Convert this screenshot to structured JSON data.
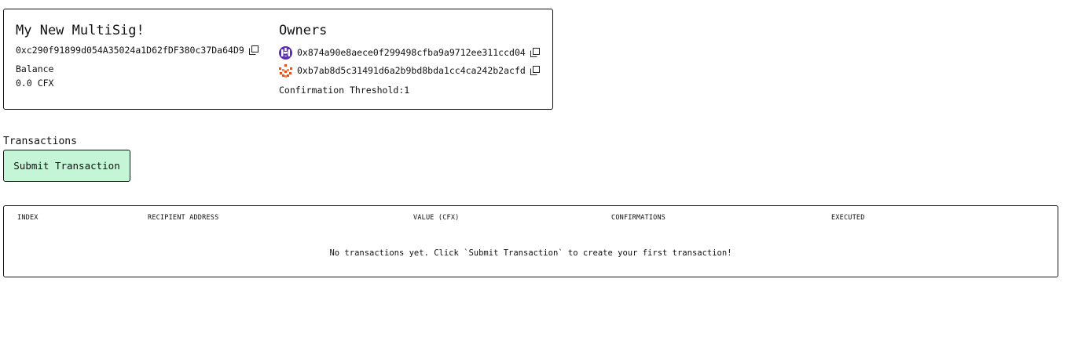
{
  "wallet": {
    "name": "My New MultiSig!",
    "address": "0xc290f91899d054A35024a1D62fDF380c37Da64D9",
    "balance_label": "Balance",
    "balance_value": "0.0 CFX"
  },
  "owners": {
    "title": "Owners",
    "items": [
      {
        "address": "0x874a90e8aece0f299498cfba9a9712ee311ccd04",
        "avatar": "identicon-purple",
        "color": "#5b2bb5"
      },
      {
        "address": "0xb7ab8d5c31491d6a2b9bd8bda1cc4ca242b2acfd",
        "avatar": "identicon-orange",
        "color": "#e8501c"
      }
    ],
    "threshold_text": "Confirmation Threshold:1"
  },
  "transactions": {
    "heading": "Transactions",
    "submit_label": "Submit Transaction",
    "submit_color": "#c4f5d6",
    "columns": [
      "INDEX",
      "RECIPIENT ADDRESS",
      "VALUE (CFX)",
      "CONFIRMATIONS",
      "EXECUTED"
    ],
    "empty_message": "No transactions yet. Click `Submit Transaction` to create your first transaction!"
  }
}
